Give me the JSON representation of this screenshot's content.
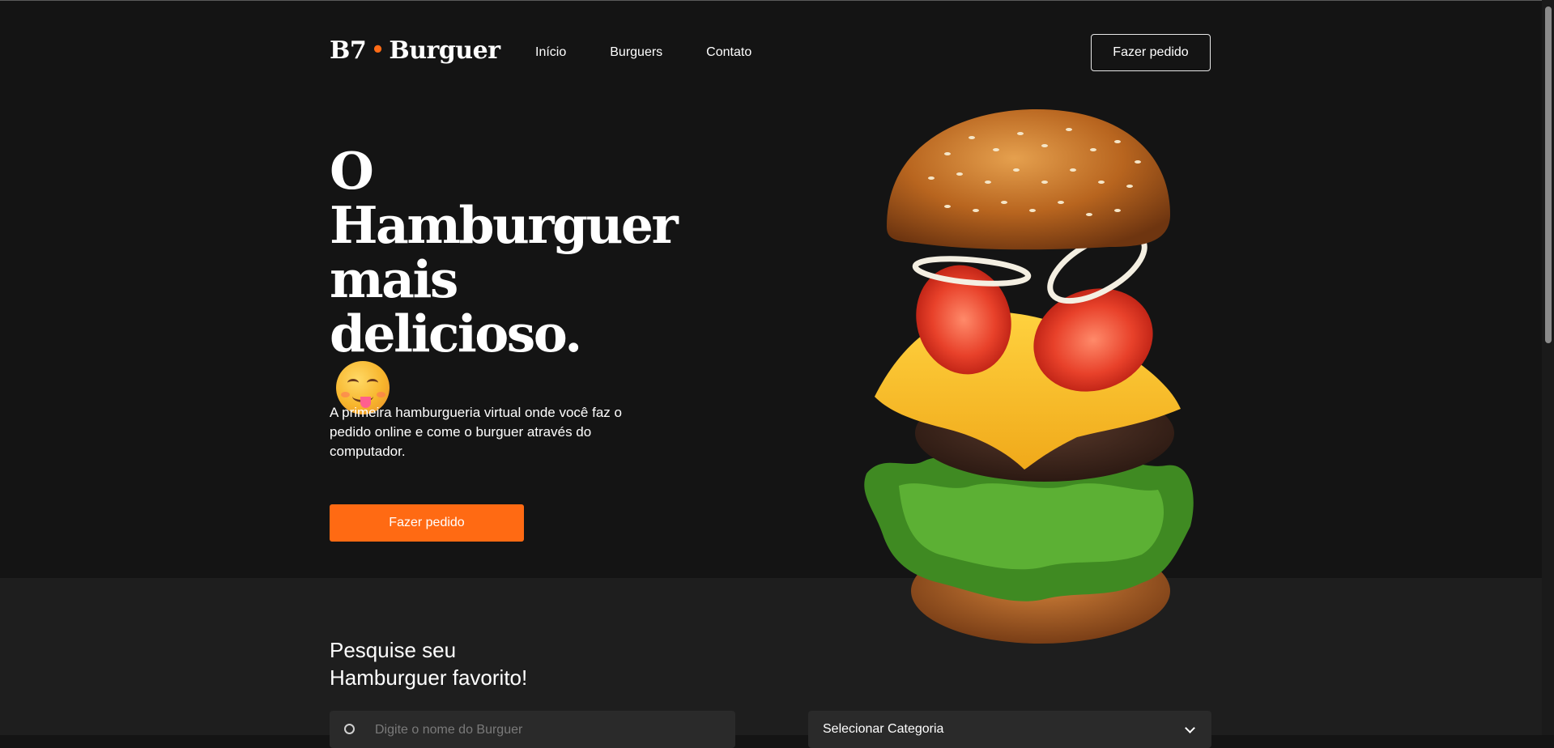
{
  "brand": {
    "name_left": "B7",
    "separator": "•",
    "name_right": "Burguer"
  },
  "nav": {
    "items": [
      "Início",
      "Burguers",
      "Contato"
    ]
  },
  "header": {
    "cta": "Fazer pedido"
  },
  "hero": {
    "headline_lines": [
      "O",
      "Hamburguer",
      "mais",
      "delicioso."
    ],
    "emoji": "yum-face-emoji",
    "description": "A primeira hamburgueria virtual onde você faz o pedido online e come o burguer através do computador.",
    "cta": "Fazer pedido",
    "image": "floating-burger-image"
  },
  "search": {
    "title_line1": "Pesquise seu",
    "title_line2": "Hamburguer favorito!",
    "placeholder": "Digite o nome do Burguer",
    "category_label": "Selecionar Categoria",
    "search_icon": "search-icon",
    "dropdown_icon": "chevron-down-icon"
  },
  "colors": {
    "accent": "#ff6a13",
    "background": "#141414",
    "section_bg": "#1e1e1e",
    "input_bg": "#2a2a2a"
  }
}
